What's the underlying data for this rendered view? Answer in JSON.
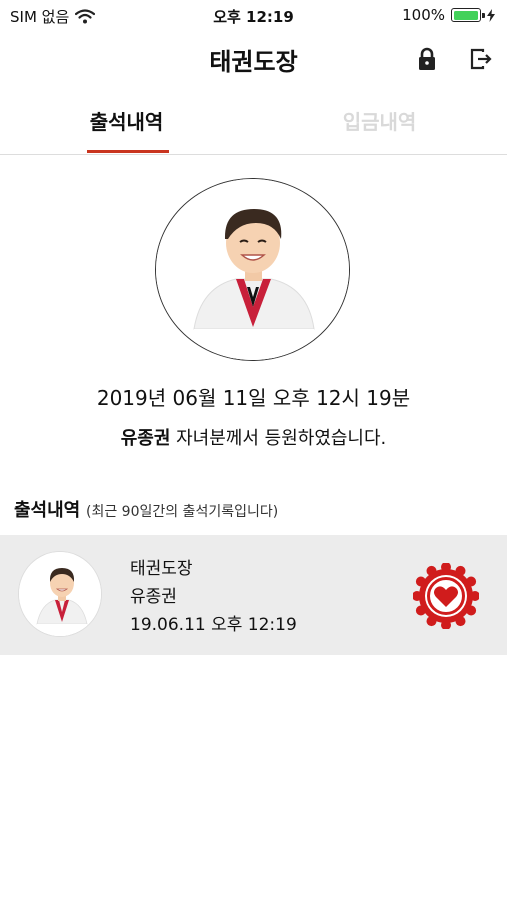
{
  "status_bar": {
    "carrier": "SIM 없음",
    "time": "오후 12:19",
    "battery_percent": "100%",
    "battery_level": 1.0
  },
  "nav": {
    "title": "태권도장",
    "lock_icon": "lock-icon",
    "logout_icon": "logout-icon"
  },
  "tabs": [
    {
      "label": "출석내역",
      "active": true
    },
    {
      "label": "입금내역",
      "active": false
    }
  ],
  "attendance": {
    "datetime": "2019년 06월 11일 오후 12시 19분",
    "student_name": "유종권",
    "message_suffix": " 자녀분께서 등원하였습니다."
  },
  "history": {
    "title": "출석내역",
    "subtitle": "(최근 90일간의 출석기록입니다)",
    "items": [
      {
        "dojo": "태권도장",
        "name": "유종권",
        "datetime": "19.06.11 오후 12:19",
        "stamp_icon": "heart-stamp-icon"
      }
    ]
  },
  "colors": {
    "accent": "#c9351f",
    "stamp_red": "#d01c1c",
    "inactive_tab": "#d9d9d9",
    "row_bg": "#ececec",
    "battery_green": "#43d15a"
  }
}
